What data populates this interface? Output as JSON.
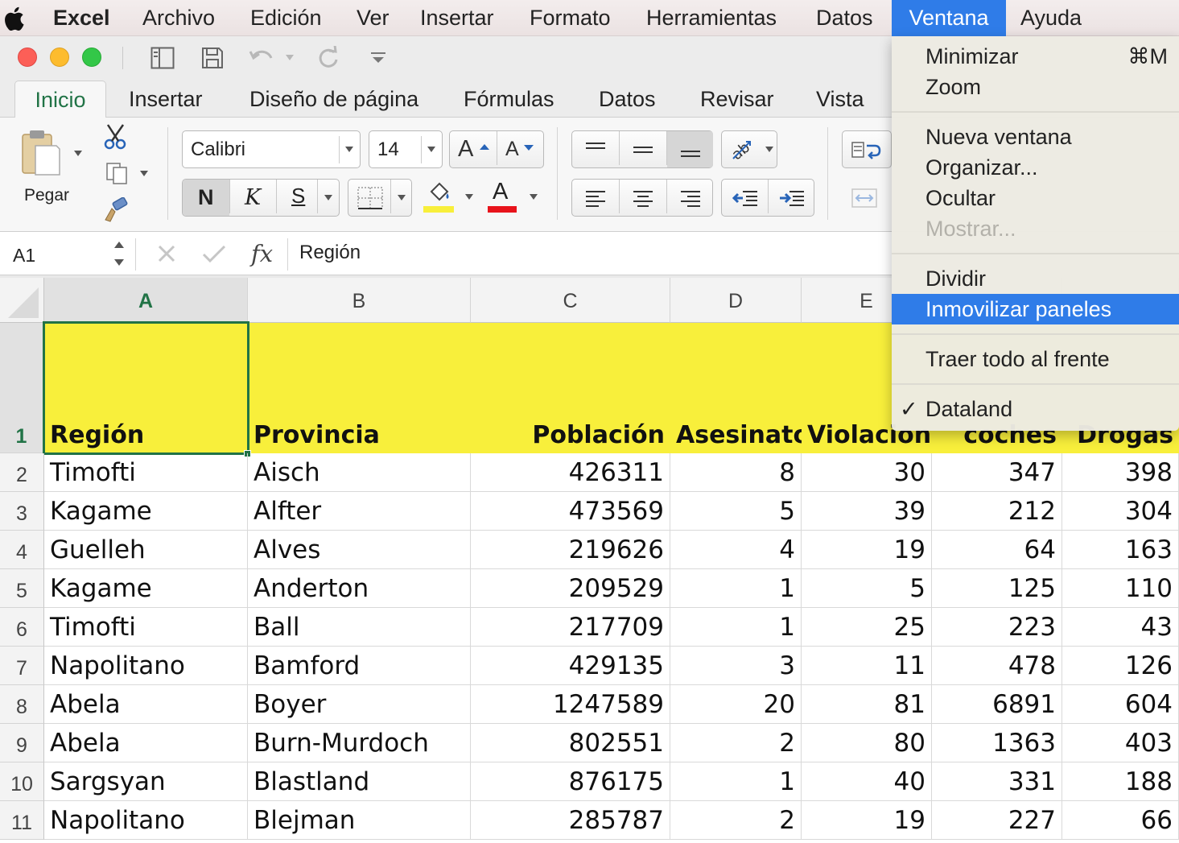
{
  "menubar": {
    "app": "Excel",
    "items": [
      "Archivo",
      "Edición",
      "Ver",
      "Insertar",
      "Formato",
      "Herramientas",
      "Datos",
      "Ventana",
      "Ayuda"
    ],
    "active": "Ventana"
  },
  "ribbon": {
    "tabs": [
      "Inicio",
      "Insertar",
      "Diseño de página",
      "Fórmulas",
      "Datos",
      "Revisar",
      "Vista"
    ],
    "selected_tab": "Inicio",
    "paste_label": "Pegar",
    "font_name": "Calibri",
    "font_size": "14",
    "grow_font": "A",
    "shrink_font": "A",
    "bold": "N",
    "italic": "K",
    "underline": "S",
    "font_color_letter": "A",
    "fill_color": "#f8ef3b",
    "font_color": "#e8131b"
  },
  "formula_bar": {
    "name_box": "A1",
    "fx": "fx",
    "content": "Región"
  },
  "sheet": {
    "columns": [
      "A",
      "B",
      "C",
      "D",
      "E"
    ],
    "selected_cell": "A1",
    "header_fill": "#f8ef3b",
    "header_row": [
      "Región",
      "Provincia",
      "Población",
      "Asesinato",
      "Violacion",
      "coches",
      "Drogas"
    ],
    "rows": [
      {
        "n": "2",
        "cells": [
          "Timofti",
          "Aisch",
          "426311",
          "8",
          "30",
          "347",
          "398"
        ]
      },
      {
        "n": "3",
        "cells": [
          "Kagame",
          "Alfter",
          "473569",
          "5",
          "39",
          "212",
          "304"
        ]
      },
      {
        "n": "4",
        "cells": [
          "Guelleh",
          "Alves",
          "219626",
          "4",
          "19",
          "64",
          "163"
        ]
      },
      {
        "n": "5",
        "cells": [
          "Kagame",
          "Anderton",
          "209529",
          "1",
          "5",
          "125",
          "110"
        ]
      },
      {
        "n": "6",
        "cells": [
          "Timofti",
          "Ball",
          "217709",
          "1",
          "25",
          "223",
          "43"
        ]
      },
      {
        "n": "7",
        "cells": [
          "Napolitano",
          "Bamford",
          "429135",
          "3",
          "11",
          "478",
          "126"
        ]
      },
      {
        "n": "8",
        "cells": [
          "Abela",
          "Boyer",
          "1247589",
          "20",
          "81",
          "6891",
          "604"
        ]
      },
      {
        "n": "9",
        "cells": [
          "Abela",
          "Burn-Murdoch",
          "802551",
          "2",
          "80",
          "1363",
          "403"
        ]
      },
      {
        "n": "10",
        "cells": [
          "Sargsyan",
          "Blastland",
          "876175",
          "1",
          "40",
          "331",
          "188"
        ]
      },
      {
        "n": "11",
        "cells": [
          "Napolitano",
          "Blejman",
          "285787",
          "2",
          "19",
          "227",
          "66"
        ]
      }
    ]
  },
  "window_menu": {
    "minimize": "Minimizar",
    "minimize_shortcut": "⌘M",
    "zoom": "Zoom",
    "new_window": "Nueva ventana",
    "arrange": "Organizar...",
    "hide": "Ocultar",
    "show": "Mostrar...",
    "split": "Dividir",
    "freeze_panes": "Inmovilizar paneles",
    "bring_all_to_front": "Traer todo al frente",
    "check": "✓",
    "workbook": "Dataland"
  },
  "colors": {
    "accent": "#217346",
    "highlight": "#2f7ce8",
    "close": "#fc5f57",
    "minimize": "#fdbc2e",
    "maximize": "#33c748"
  }
}
